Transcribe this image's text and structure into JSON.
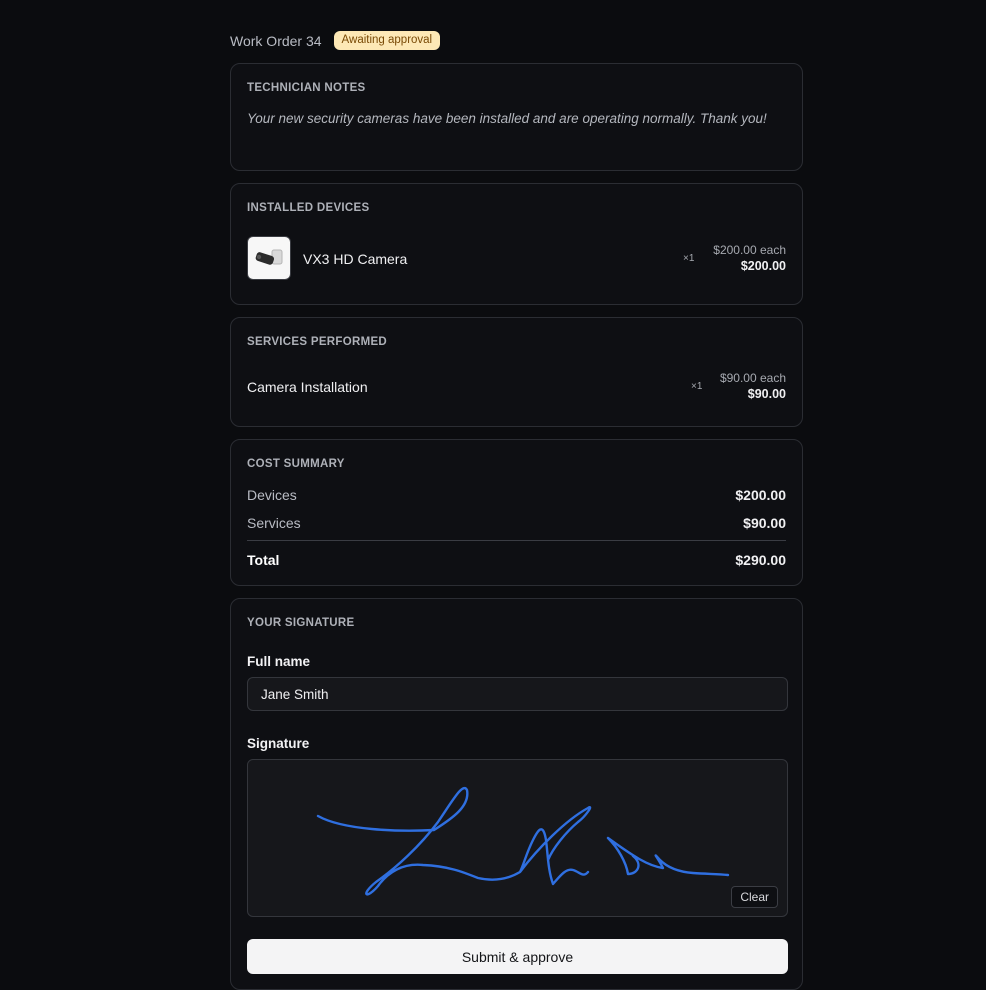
{
  "work_order": {
    "title": "Work Order 34",
    "status": "Awaiting approval"
  },
  "technician_notes": {
    "heading": "TECHNICIAN NOTES",
    "text": "Your new security cameras have been installed and are operating normally. Thank you!"
  },
  "installed_devices": {
    "heading": "INSTALLED DEVICES",
    "items": [
      {
        "name": "VX3 HD Camera",
        "qty": "×1",
        "each": "$200.00 each",
        "total": "$200.00",
        "icon": "camera-thumbnail"
      }
    ]
  },
  "services_performed": {
    "heading": "SERVICES PERFORMED",
    "items": [
      {
        "name": "Camera Installation",
        "qty": "×1",
        "each": "$90.00 each",
        "total": "$90.00"
      }
    ]
  },
  "cost_summary": {
    "heading": "COST SUMMARY",
    "devices_label": "Devices",
    "devices_value": "$200.00",
    "services_label": "Services",
    "services_value": "$90.00",
    "total_label": "Total",
    "total_value": "$290.00"
  },
  "signature": {
    "heading": "YOUR SIGNATURE",
    "full_name_label": "Full name",
    "full_name_value": "Jane Smith",
    "signature_label": "Signature",
    "clear_label": "Clear",
    "stroke_color": "#2f6fe0"
  },
  "actions": {
    "submit_label": "Submit & approve"
  },
  "colors": {
    "background": "#0b0c0f",
    "badge_bg": "#fde8b6",
    "badge_text": "#7a4a06"
  }
}
